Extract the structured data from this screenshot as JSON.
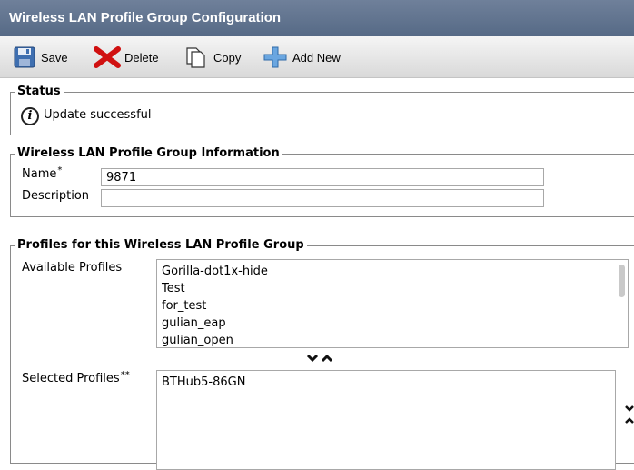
{
  "header": {
    "title": "Wireless LAN Profile Group Configuration"
  },
  "toolbar": {
    "save_label": "Save",
    "delete_label": "Delete",
    "copy_label": "Copy",
    "add_new_label": "Add New"
  },
  "status": {
    "legend": "Status",
    "message": "Update successful"
  },
  "group_info": {
    "legend": "Wireless LAN Profile Group Information",
    "name_label": "Name",
    "name_required": "*",
    "name_value": "9871",
    "description_label": "Description",
    "description_value": ""
  },
  "profiles": {
    "legend": "Profiles for this Wireless LAN Profile Group",
    "available_label": "Available Profiles",
    "available_items": [
      "Gorilla-dot1x-hide",
      "Test",
      "for_test",
      "gulian_eap",
      "gulian_open"
    ],
    "selected_label": "Selected Profiles",
    "selected_required": "**",
    "selected_items": [
      "BTHub5-86GN"
    ]
  },
  "icons": {
    "save": "floppy-disk-icon",
    "delete": "red-x-icon",
    "copy": "document-copy-icon",
    "add_new": "plus-icon",
    "info": "info-icon"
  }
}
